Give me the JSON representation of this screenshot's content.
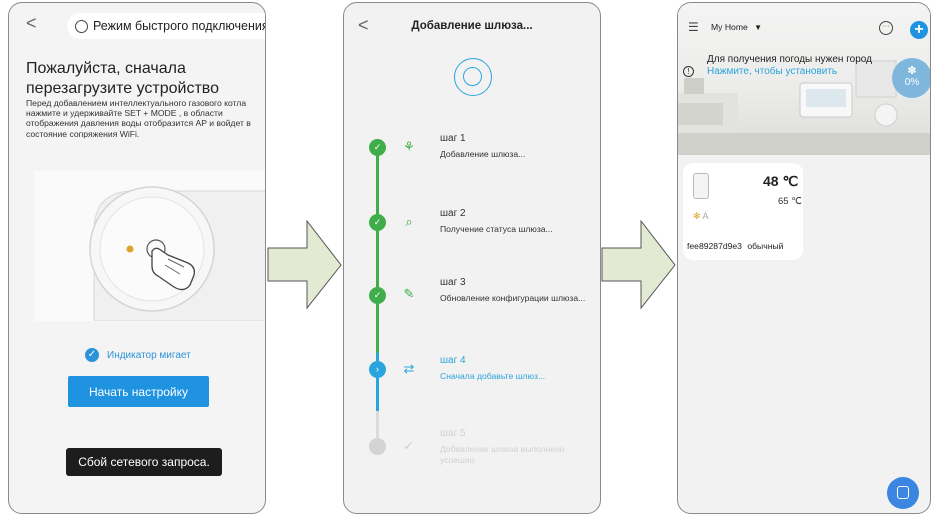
{
  "screen1": {
    "back": "<",
    "mode_label": "Режим быстрого подключения",
    "title": "Пожалуйста, сначала перезагрузите устройство",
    "description": "Перед добавлением интеллектуального газового котла нажмите и удерживайте SET + MODE , в области отображения давления воды отобразится AP и войдет в состояние сопряжения WiFi.",
    "indicator_label": "Индикатор мигает",
    "start_button": "Начать настройку",
    "toast": "Сбой сетевого запроса."
  },
  "screen2": {
    "back": "<",
    "title": "Добавление шлюза...",
    "steps": [
      {
        "label": "шаг 1",
        "desc": "Добавление шлюза...",
        "state": "done"
      },
      {
        "label": "шаг 2",
        "desc": "Получение статуса шлюза...",
        "state": "done"
      },
      {
        "label": "шаг 3",
        "desc": "Обновление конфигурации шлюза...",
        "state": "done"
      },
      {
        "label": "шаг 4",
        "desc": "Сначала добавьте шлюз...",
        "state": "active"
      },
      {
        "label": "шаг 5",
        "desc": "Добавление шлюза выполнено успешно",
        "state": "pending"
      }
    ]
  },
  "screen3": {
    "home": "My Home",
    "weather_text": "Для получения погоды нужен город",
    "weather_link": "Нажмите, чтобы установить",
    "humidity": "0%",
    "device": {
      "temp": "48 ℃",
      "set_temp": "65 ℃",
      "id": "fee89287d9e3",
      "mode": "обычный"
    }
  },
  "colors": {
    "accent": "#1f93e0",
    "green": "#3fae4a",
    "toast": "#1d1d1d"
  }
}
